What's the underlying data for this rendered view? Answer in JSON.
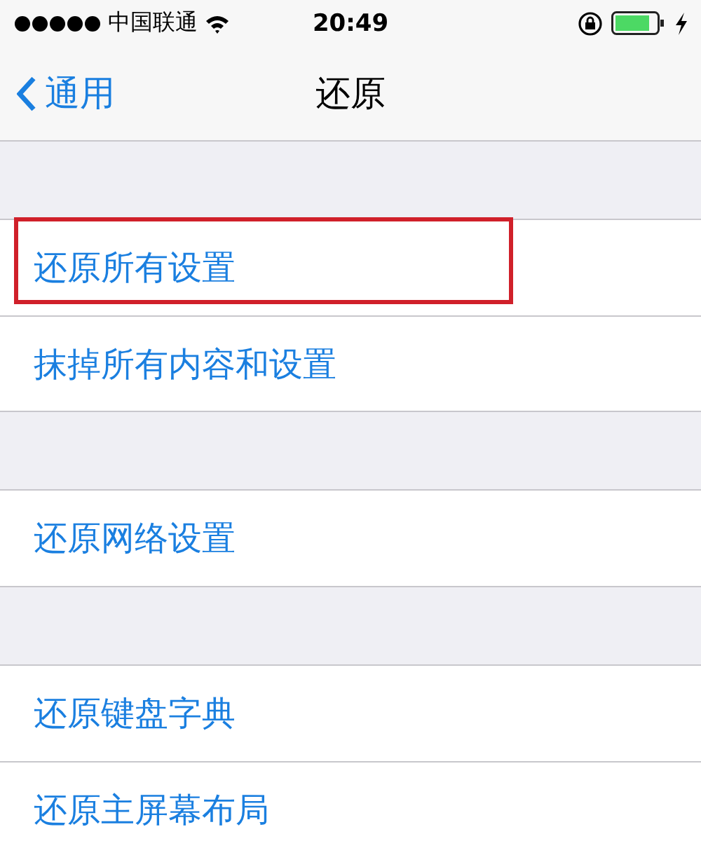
{
  "status_bar": {
    "carrier": "中国联通",
    "time": "20:49"
  },
  "nav_bar": {
    "back": "通用",
    "title": "还原"
  },
  "groups": [
    {
      "items": [
        {
          "label": "还原所有设置",
          "highlighted": true
        },
        {
          "label": "抹掉所有内容和设置",
          "highlighted": false
        }
      ]
    },
    {
      "items": [
        {
          "label": "还原网络设置",
          "highlighted": false
        }
      ]
    },
    {
      "items": [
        {
          "label": "还原键盘字典",
          "highlighted": false
        },
        {
          "label": "还原主屏幕布局",
          "highlighted": false
        }
      ]
    }
  ]
}
